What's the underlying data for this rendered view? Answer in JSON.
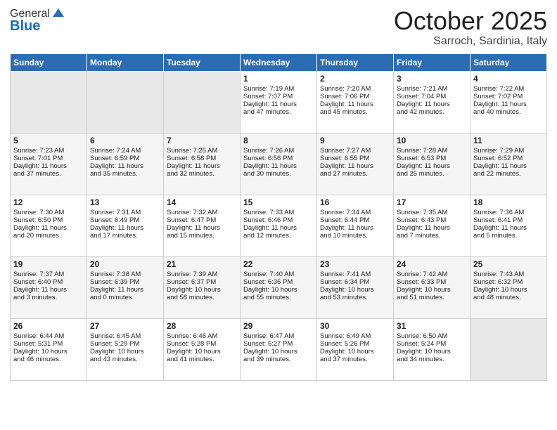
{
  "header": {
    "logo_general": "General",
    "logo_blue": "Blue",
    "month": "October 2025",
    "location": "Sarroch, Sardinia, Italy"
  },
  "weekdays": [
    "Sunday",
    "Monday",
    "Tuesday",
    "Wednesday",
    "Thursday",
    "Friday",
    "Saturday"
  ],
  "weeks": [
    [
      {
        "day": "",
        "info": ""
      },
      {
        "day": "",
        "info": ""
      },
      {
        "day": "",
        "info": ""
      },
      {
        "day": "1",
        "info": "Sunrise: 7:19 AM\nSunset: 7:07 PM\nDaylight: 11 hours\nand 47 minutes."
      },
      {
        "day": "2",
        "info": "Sunrise: 7:20 AM\nSunset: 7:06 PM\nDaylight: 11 hours\nand 45 minutes."
      },
      {
        "day": "3",
        "info": "Sunrise: 7:21 AM\nSunset: 7:04 PM\nDaylight: 11 hours\nand 42 minutes."
      },
      {
        "day": "4",
        "info": "Sunrise: 7:22 AM\nSunset: 7:02 PM\nDaylight: 11 hours\nand 40 minutes."
      }
    ],
    [
      {
        "day": "5",
        "info": "Sunrise: 7:23 AM\nSunset: 7:01 PM\nDaylight: 11 hours\nand 37 minutes."
      },
      {
        "day": "6",
        "info": "Sunrise: 7:24 AM\nSunset: 6:59 PM\nDaylight: 11 hours\nand 35 minutes."
      },
      {
        "day": "7",
        "info": "Sunrise: 7:25 AM\nSunset: 6:58 PM\nDaylight: 11 hours\nand 32 minutes."
      },
      {
        "day": "8",
        "info": "Sunrise: 7:26 AM\nSunset: 6:56 PM\nDaylight: 11 hours\nand 30 minutes."
      },
      {
        "day": "9",
        "info": "Sunrise: 7:27 AM\nSunset: 6:55 PM\nDaylight: 11 hours\nand 27 minutes."
      },
      {
        "day": "10",
        "info": "Sunrise: 7:28 AM\nSunset: 6:53 PM\nDaylight: 11 hours\nand 25 minutes."
      },
      {
        "day": "11",
        "info": "Sunrise: 7:29 AM\nSunset: 6:52 PM\nDaylight: 11 hours\nand 22 minutes."
      }
    ],
    [
      {
        "day": "12",
        "info": "Sunrise: 7:30 AM\nSunset: 6:50 PM\nDaylight: 11 hours\nand 20 minutes."
      },
      {
        "day": "13",
        "info": "Sunrise: 7:31 AM\nSunset: 6:49 PM\nDaylight: 11 hours\nand 17 minutes."
      },
      {
        "day": "14",
        "info": "Sunrise: 7:32 AM\nSunset: 6:47 PM\nDaylight: 11 hours\nand 15 minutes."
      },
      {
        "day": "15",
        "info": "Sunrise: 7:33 AM\nSunset: 6:46 PM\nDaylight: 11 hours\nand 12 minutes."
      },
      {
        "day": "16",
        "info": "Sunrise: 7:34 AM\nSunset: 6:44 PM\nDaylight: 11 hours\nand 10 minutes."
      },
      {
        "day": "17",
        "info": "Sunrise: 7:35 AM\nSunset: 6:43 PM\nDaylight: 11 hours\nand 7 minutes."
      },
      {
        "day": "18",
        "info": "Sunrise: 7:36 AM\nSunset: 6:41 PM\nDaylight: 11 hours\nand 5 minutes."
      }
    ],
    [
      {
        "day": "19",
        "info": "Sunrise: 7:37 AM\nSunset: 6:40 PM\nDaylight: 11 hours\nand 3 minutes."
      },
      {
        "day": "20",
        "info": "Sunrise: 7:38 AM\nSunset: 6:39 PM\nDaylight: 11 hours\nand 0 minutes."
      },
      {
        "day": "21",
        "info": "Sunrise: 7:39 AM\nSunset: 6:37 PM\nDaylight: 10 hours\nand 58 minutes."
      },
      {
        "day": "22",
        "info": "Sunrise: 7:40 AM\nSunset: 6:36 PM\nDaylight: 10 hours\nand 55 minutes."
      },
      {
        "day": "23",
        "info": "Sunrise: 7:41 AM\nSunset: 6:34 PM\nDaylight: 10 hours\nand 53 minutes."
      },
      {
        "day": "24",
        "info": "Sunrise: 7:42 AM\nSunset: 6:33 PM\nDaylight: 10 hours\nand 51 minutes."
      },
      {
        "day": "25",
        "info": "Sunrise: 7:43 AM\nSunset: 6:32 PM\nDaylight: 10 hours\nand 48 minutes."
      }
    ],
    [
      {
        "day": "26",
        "info": "Sunrise: 6:44 AM\nSunset: 5:31 PM\nDaylight: 10 hours\nand 46 minutes."
      },
      {
        "day": "27",
        "info": "Sunrise: 6:45 AM\nSunset: 5:29 PM\nDaylight: 10 hours\nand 43 minutes."
      },
      {
        "day": "28",
        "info": "Sunrise: 6:46 AM\nSunset: 5:28 PM\nDaylight: 10 hours\nand 41 minutes."
      },
      {
        "day": "29",
        "info": "Sunrise: 6:47 AM\nSunset: 5:27 PM\nDaylight: 10 hours\nand 39 minutes."
      },
      {
        "day": "30",
        "info": "Sunrise: 6:49 AM\nSunset: 5:26 PM\nDaylight: 10 hours\nand 37 minutes."
      },
      {
        "day": "31",
        "info": "Sunrise: 6:50 AM\nSunset: 5:24 PM\nDaylight: 10 hours\nand 34 minutes."
      },
      {
        "day": "",
        "info": ""
      }
    ]
  ]
}
